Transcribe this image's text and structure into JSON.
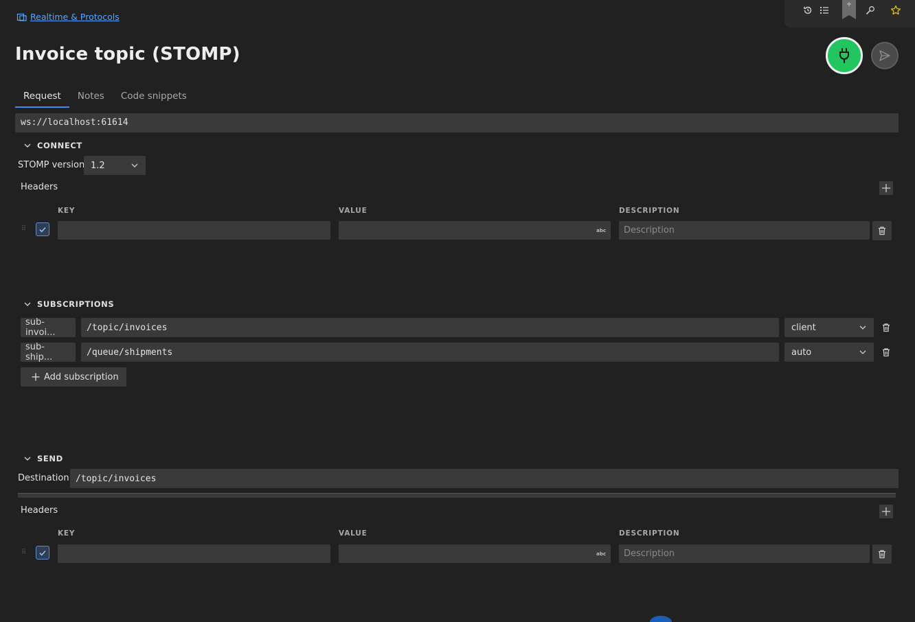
{
  "breadcrumb": {
    "icon": "collection-icon",
    "label": "Realtime & Protocols"
  },
  "page": {
    "title": "Invoice topic (STOMP)"
  },
  "toolbar": {
    "icons": [
      "history-icon",
      "list-icon",
      "bookmark-icon",
      "wrench-icon",
      "star-icon"
    ],
    "bookmark_plus": "+"
  },
  "actions": {
    "connect_icon": "plug-icon",
    "send_icon": "send-icon",
    "connect_color": "#22c55e"
  },
  "tabs": [
    {
      "label": "Request",
      "active": true
    },
    {
      "label": "Notes",
      "active": false
    },
    {
      "label": "Code snippets",
      "active": false
    }
  ],
  "url": "ws://localhost:61614",
  "connect": {
    "title": "CONNECT",
    "version_label": "STOMP version:",
    "version_value": "1.2",
    "headers_label": "Headers",
    "columns": {
      "key": "KEY",
      "value": "VALUE",
      "description": "DESCRIPTION"
    },
    "row": {
      "key": "",
      "value": "",
      "value_badge": "abc",
      "description_placeholder": "Description",
      "checked": true
    }
  },
  "subscriptions": {
    "title": "SUBSCRIPTIONS",
    "items": [
      {
        "id": "sub-invoi...",
        "destination": "/topic/invoices",
        "ack": "client"
      },
      {
        "id": "sub-ship...",
        "destination": "/queue/shipments",
        "ack": "auto"
      }
    ],
    "add_label": "Add subscription"
  },
  "send": {
    "title": "SEND",
    "destination_label": "Destination:",
    "destination_value": "/topic/invoices",
    "headers_label": "Headers",
    "columns": {
      "key": "KEY",
      "value": "VALUE",
      "description": "DESCRIPTION"
    },
    "row": {
      "key": "",
      "value": "",
      "value_badge": "abc",
      "description_placeholder": "Description",
      "checked": true
    }
  }
}
